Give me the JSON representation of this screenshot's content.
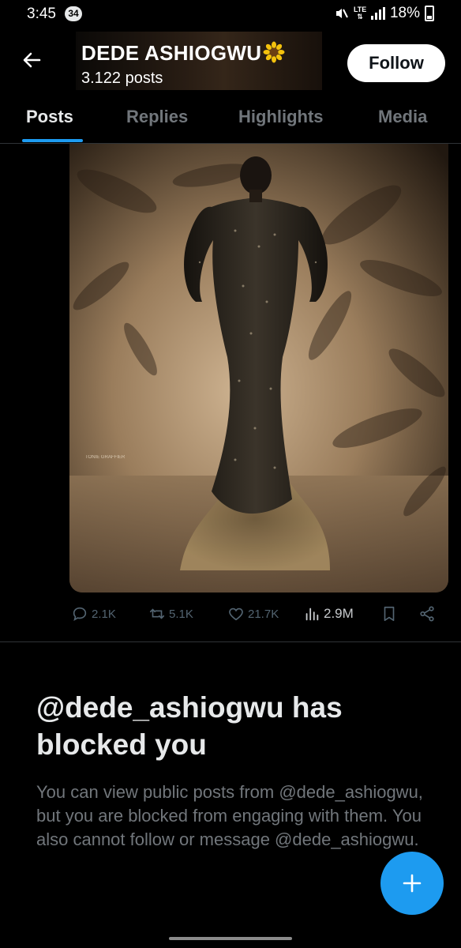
{
  "status_bar": {
    "time": "3:45",
    "notification_count": "34",
    "network": "LTE",
    "battery": "18%",
    "icons": [
      "mute-icon",
      "lte-icon",
      "signal-icon",
      "battery-icon"
    ]
  },
  "header": {
    "name": "DEDE ASHIOGWU",
    "name_emoji": "sunflower-icon",
    "posts_count": "3.122 posts",
    "follow_label": "Follow"
  },
  "tabs": [
    {
      "label": "Posts",
      "active": true
    },
    {
      "label": "Replies",
      "active": false
    },
    {
      "label": "Highlights",
      "active": false
    },
    {
      "label": "Media",
      "active": false
    }
  ],
  "post": {
    "media_watermark": "TONIE GRAFFIER",
    "actions": {
      "replies": "2.1K",
      "reposts": "5.1K",
      "likes": "21.7K",
      "views": "2.9M"
    }
  },
  "blocked": {
    "title": "@dede_ashiogwu has blocked you",
    "description": "You can view public posts from @dede_ashiogwu, but you are blocked from engaging with them. You also cannot follow or message @dede_ashiogwu."
  },
  "colors": {
    "accent": "#1d9bf0",
    "background": "#000000",
    "secondary_text": "#71767b",
    "primary_text": "#e7e9ea"
  }
}
